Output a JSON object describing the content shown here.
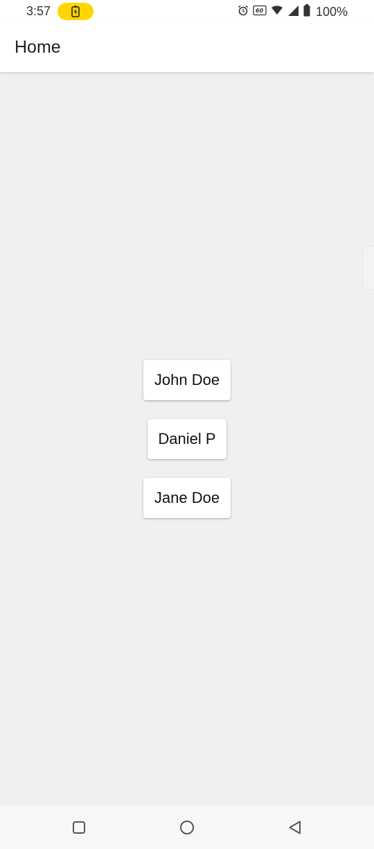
{
  "status_bar": {
    "time": "3:57",
    "battery_percent": "100%",
    "icons": [
      "battery-charging-icon",
      "alarm-icon",
      "hd-60-icon",
      "wifi-icon",
      "signal-icon",
      "battery-icon"
    ],
    "accent_color": "#ffd600"
  },
  "app_bar": {
    "title": "Home"
  },
  "main": {
    "buttons": [
      {
        "label": "John Doe"
      },
      {
        "label": "Daniel P"
      },
      {
        "label": "Jane Doe"
      }
    ]
  },
  "nav_bar": {
    "icons": [
      "recent-apps-icon",
      "home-icon",
      "back-icon"
    ]
  }
}
